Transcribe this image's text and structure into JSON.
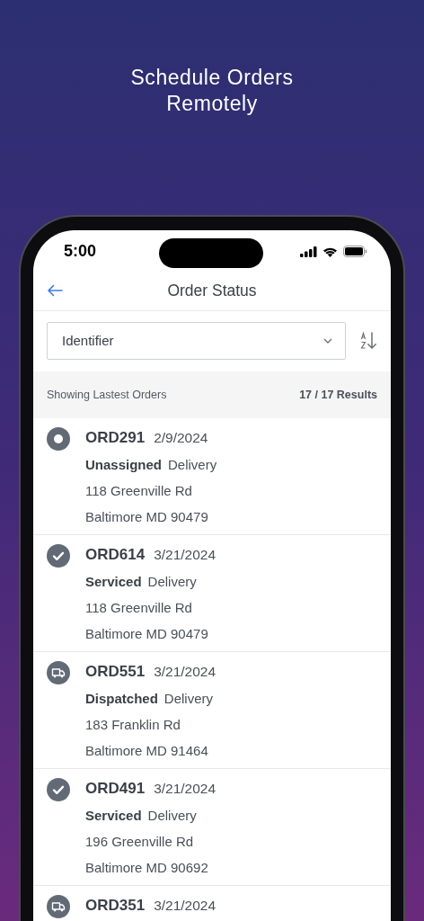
{
  "headline": [
    "Schedule Orders",
    "Remotely"
  ],
  "status_bar": {
    "time": "5:00"
  },
  "nav": {
    "title": "Order Status"
  },
  "filter": {
    "value": "Identifier"
  },
  "summary": {
    "label": "Showing Lastest Orders",
    "count": "17 / 17 Results"
  },
  "orders": [
    {
      "kind": "unassigned",
      "id": "ORD291",
      "date": "2/9/2024",
      "status": "Unassigned",
      "type": "Delivery",
      "street": "118 Greenville Rd",
      "city": "Baltimore MD 90479"
    },
    {
      "kind": "serviced",
      "id": "ORD614",
      "date": "3/21/2024",
      "status": "Serviced",
      "type": "Delivery",
      "street": "118 Greenville Rd",
      "city": "Baltimore MD 90479"
    },
    {
      "kind": "dispatched",
      "id": "ORD551",
      "date": "3/21/2024",
      "status": "Dispatched",
      "type": "Delivery",
      "street": "183 Franklin Rd",
      "city": "Baltimore MD 91464"
    },
    {
      "kind": "serviced",
      "id": "ORD491",
      "date": "3/21/2024",
      "status": "Serviced",
      "type": "Delivery",
      "street": "196 Greenville Rd",
      "city": "Baltimore MD 90692"
    },
    {
      "kind": "dispatched",
      "id": "ORD351",
      "date": "3/21/2024"
    }
  ]
}
